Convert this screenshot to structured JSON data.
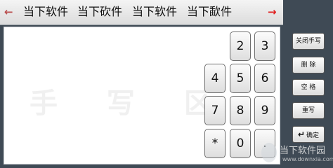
{
  "candidates": {
    "prev_arrow": "←",
    "items": [
      "当下软件",
      "当下砍件",
      "当下软件",
      "当下歃件"
    ],
    "next_arrow": "→"
  },
  "handwriting_area": {
    "watermark": "手 写 区"
  },
  "keypad": {
    "keys": [
      "2",
      "3",
      "4",
      "5",
      "6",
      "7",
      "8",
      "9",
      "*",
      "0",
      "."
    ]
  },
  "side_buttons": {
    "close_handwriting": "关闭手写",
    "delete": "删 除",
    "space": "空 格",
    "rewrite": "重写",
    "confirm": "确定",
    "confirm_icon": "↵"
  },
  "watermark_site": {
    "name": "当下软件园",
    "url": "www.downxia.com"
  }
}
